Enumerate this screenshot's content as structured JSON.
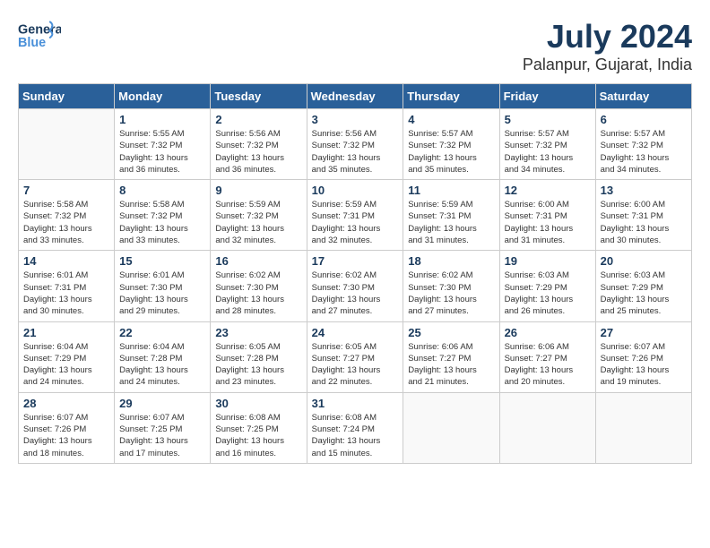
{
  "header": {
    "logo_line1": "General",
    "logo_line2": "Blue",
    "month_year": "July 2024",
    "location": "Palanpur, Gujarat, India"
  },
  "weekdays": [
    "Sunday",
    "Monday",
    "Tuesday",
    "Wednesday",
    "Thursday",
    "Friday",
    "Saturday"
  ],
  "weeks": [
    [
      {
        "day": "",
        "info": ""
      },
      {
        "day": "1",
        "info": "Sunrise: 5:55 AM\nSunset: 7:32 PM\nDaylight: 13 hours\nand 36 minutes."
      },
      {
        "day": "2",
        "info": "Sunrise: 5:56 AM\nSunset: 7:32 PM\nDaylight: 13 hours\nand 36 minutes."
      },
      {
        "day": "3",
        "info": "Sunrise: 5:56 AM\nSunset: 7:32 PM\nDaylight: 13 hours\nand 35 minutes."
      },
      {
        "day": "4",
        "info": "Sunrise: 5:57 AM\nSunset: 7:32 PM\nDaylight: 13 hours\nand 35 minutes."
      },
      {
        "day": "5",
        "info": "Sunrise: 5:57 AM\nSunset: 7:32 PM\nDaylight: 13 hours\nand 34 minutes."
      },
      {
        "day": "6",
        "info": "Sunrise: 5:57 AM\nSunset: 7:32 PM\nDaylight: 13 hours\nand 34 minutes."
      }
    ],
    [
      {
        "day": "7",
        "info": "Sunrise: 5:58 AM\nSunset: 7:32 PM\nDaylight: 13 hours\nand 33 minutes."
      },
      {
        "day": "8",
        "info": "Sunrise: 5:58 AM\nSunset: 7:32 PM\nDaylight: 13 hours\nand 33 minutes."
      },
      {
        "day": "9",
        "info": "Sunrise: 5:59 AM\nSunset: 7:32 PM\nDaylight: 13 hours\nand 32 minutes."
      },
      {
        "day": "10",
        "info": "Sunrise: 5:59 AM\nSunset: 7:31 PM\nDaylight: 13 hours\nand 32 minutes."
      },
      {
        "day": "11",
        "info": "Sunrise: 5:59 AM\nSunset: 7:31 PM\nDaylight: 13 hours\nand 31 minutes."
      },
      {
        "day": "12",
        "info": "Sunrise: 6:00 AM\nSunset: 7:31 PM\nDaylight: 13 hours\nand 31 minutes."
      },
      {
        "day": "13",
        "info": "Sunrise: 6:00 AM\nSunset: 7:31 PM\nDaylight: 13 hours\nand 30 minutes."
      }
    ],
    [
      {
        "day": "14",
        "info": "Sunrise: 6:01 AM\nSunset: 7:31 PM\nDaylight: 13 hours\nand 30 minutes."
      },
      {
        "day": "15",
        "info": "Sunrise: 6:01 AM\nSunset: 7:30 PM\nDaylight: 13 hours\nand 29 minutes."
      },
      {
        "day": "16",
        "info": "Sunrise: 6:02 AM\nSunset: 7:30 PM\nDaylight: 13 hours\nand 28 minutes."
      },
      {
        "day": "17",
        "info": "Sunrise: 6:02 AM\nSunset: 7:30 PM\nDaylight: 13 hours\nand 27 minutes."
      },
      {
        "day": "18",
        "info": "Sunrise: 6:02 AM\nSunset: 7:30 PM\nDaylight: 13 hours\nand 27 minutes."
      },
      {
        "day": "19",
        "info": "Sunrise: 6:03 AM\nSunset: 7:29 PM\nDaylight: 13 hours\nand 26 minutes."
      },
      {
        "day": "20",
        "info": "Sunrise: 6:03 AM\nSunset: 7:29 PM\nDaylight: 13 hours\nand 25 minutes."
      }
    ],
    [
      {
        "day": "21",
        "info": "Sunrise: 6:04 AM\nSunset: 7:29 PM\nDaylight: 13 hours\nand 24 minutes."
      },
      {
        "day": "22",
        "info": "Sunrise: 6:04 AM\nSunset: 7:28 PM\nDaylight: 13 hours\nand 24 minutes."
      },
      {
        "day": "23",
        "info": "Sunrise: 6:05 AM\nSunset: 7:28 PM\nDaylight: 13 hours\nand 23 minutes."
      },
      {
        "day": "24",
        "info": "Sunrise: 6:05 AM\nSunset: 7:27 PM\nDaylight: 13 hours\nand 22 minutes."
      },
      {
        "day": "25",
        "info": "Sunrise: 6:06 AM\nSunset: 7:27 PM\nDaylight: 13 hours\nand 21 minutes."
      },
      {
        "day": "26",
        "info": "Sunrise: 6:06 AM\nSunset: 7:27 PM\nDaylight: 13 hours\nand 20 minutes."
      },
      {
        "day": "27",
        "info": "Sunrise: 6:07 AM\nSunset: 7:26 PM\nDaylight: 13 hours\nand 19 minutes."
      }
    ],
    [
      {
        "day": "28",
        "info": "Sunrise: 6:07 AM\nSunset: 7:26 PM\nDaylight: 13 hours\nand 18 minutes."
      },
      {
        "day": "29",
        "info": "Sunrise: 6:07 AM\nSunset: 7:25 PM\nDaylight: 13 hours\nand 17 minutes."
      },
      {
        "day": "30",
        "info": "Sunrise: 6:08 AM\nSunset: 7:25 PM\nDaylight: 13 hours\nand 16 minutes."
      },
      {
        "day": "31",
        "info": "Sunrise: 6:08 AM\nSunset: 7:24 PM\nDaylight: 13 hours\nand 15 minutes."
      },
      {
        "day": "",
        "info": ""
      },
      {
        "day": "",
        "info": ""
      },
      {
        "day": "",
        "info": ""
      }
    ]
  ]
}
